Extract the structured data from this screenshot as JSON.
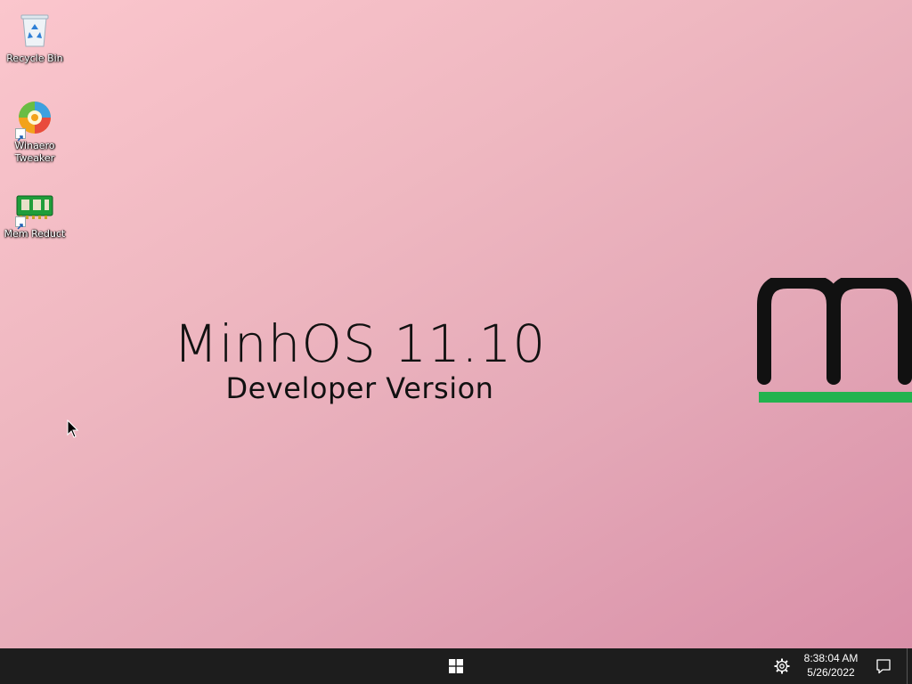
{
  "desktop": {
    "icons": [
      {
        "label": "Recycle Bin",
        "icon": "recycle-bin-icon"
      },
      {
        "label": "Winaero Tweaker",
        "icon": "winaero-tweaker-icon"
      },
      {
        "label": "Mem Reduct",
        "icon": "mem-reduct-icon"
      }
    ],
    "wallpaper": {
      "title": "MinhOS 11.10",
      "subtitle": "Developer Version",
      "logo_letter": "m",
      "colors": {
        "background_start": "#fbc6cd",
        "background_end": "#d98fa8",
        "logo": "#111111",
        "logo_underline": "#22b34f"
      }
    }
  },
  "taskbar": {
    "start_icon": "windows-start-icon",
    "settings_icon": "gear-icon",
    "time": "8:38:04 AM",
    "date": "5/26/2022",
    "notification_icon": "notification-icon",
    "colors": {
      "background": "#1d1d1d",
      "text": "#ffffff"
    }
  }
}
